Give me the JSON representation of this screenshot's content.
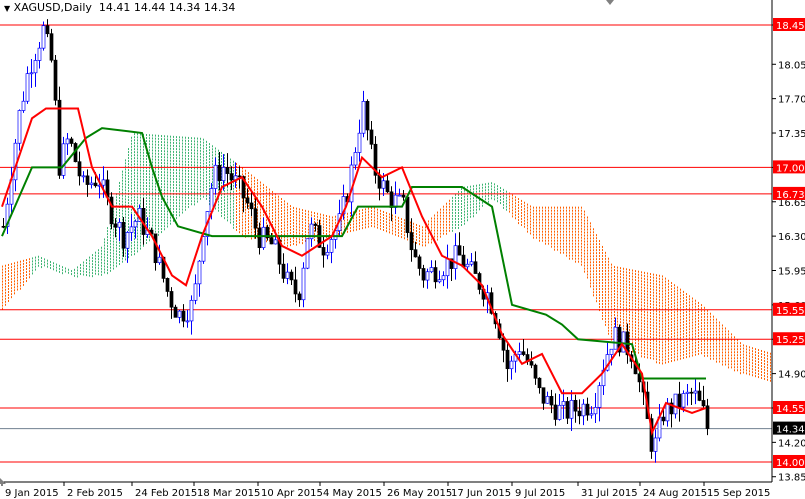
{
  "header": {
    "arrow_icon": "triangle-down",
    "symbol": "XAGUSD,Daily",
    "ohlc": "14.41 14.44 14.34 14.34"
  },
  "chart_data": {
    "type": "candlestick",
    "title": "XAGUSD,Daily",
    "ylim": [
      13.85,
      18.45
    ],
    "yticks": [
      "18.45",
      "18.05",
      "17.70",
      "17.35",
      "17.00",
      "16.65",
      "16.30",
      "15.95",
      "15.60",
      "15.25",
      "14.90",
      "14.55",
      "14.20",
      "13.85"
    ],
    "xlim_days": [
      0,
      193
    ],
    "xticks": [
      {
        "day": 0,
        "label": "9 Jan 2015"
      },
      {
        "day": 15.5,
        "label": "2 Feb 2015"
      },
      {
        "day": 32.5,
        "label": "24 Feb 2015"
      },
      {
        "day": 48,
        "label": "18 Mar 2015"
      },
      {
        "day": 64,
        "label": "10 Apr 2015"
      },
      {
        "day": 79.5,
        "label": "4 May 2015"
      },
      {
        "day": 95.5,
        "label": "26 May 2015"
      },
      {
        "day": 111.5,
        "label": "17 Jun 2015"
      },
      {
        "day": 127.5,
        "label": "9 Jul 2015"
      },
      {
        "day": 144,
        "label": "31 Jul 2015"
      },
      {
        "day": 159.5,
        "label": "24 Aug 2015"
      },
      {
        "day": 175.5,
        "label": "15 Sep 2015"
      }
    ],
    "close_path": [
      [
        0,
        16.4
      ],
      [
        3.8,
        17.5
      ],
      [
        6.3,
        18.0
      ],
      [
        10,
        18.4
      ],
      [
        12.5,
        18.0
      ],
      [
        13.8,
        17.0
      ],
      [
        16.3,
        17.3
      ],
      [
        20,
        16.8
      ],
      [
        23.8,
        16.9
      ],
      [
        26.3,
        16.6
      ],
      [
        30,
        16.3
      ],
      [
        33.8,
        16.5
      ],
      [
        37.5,
        16.2
      ],
      [
        41.3,
        15.7
      ],
      [
        43.8,
        15.5
      ],
      [
        47.5,
        15.6
      ],
      [
        50,
        16.4
      ],
      [
        52.5,
        16.9
      ],
      [
        55,
        17.0
      ],
      [
        58.8,
        16.8
      ],
      [
        61.3,
        16.6
      ],
      [
        63.8,
        16.3
      ],
      [
        67.5,
        16.2
      ],
      [
        71.3,
        15.8
      ],
      [
        73.8,
        15.7
      ],
      [
        76.3,
        16.4
      ],
      [
        80,
        16.2
      ],
      [
        83.8,
        16.4
      ],
      [
        86.3,
        16.8
      ],
      [
        88.8,
        17.4
      ],
      [
        90,
        17.6
      ],
      [
        92.5,
        17.0
      ],
      [
        96.3,
        16.7
      ],
      [
        100,
        16.6
      ],
      [
        102.5,
        16.1
      ],
      [
        105,
        15.9
      ],
      [
        110,
        16.0
      ],
      [
        113.8,
        16.1
      ],
      [
        117.5,
        15.9
      ],
      [
        121.3,
        15.7
      ],
      [
        123.8,
        15.4
      ],
      [
        126.3,
        14.9
      ],
      [
        128.8,
        15.2
      ],
      [
        131.3,
        15.0
      ],
      [
        133.8,
        14.7
      ],
      [
        136.3,
        14.6
      ],
      [
        140,
        14.5
      ],
      [
        143.8,
        14.55
      ],
      [
        147.5,
        14.6
      ],
      [
        150,
        15.0
      ],
      [
        152.5,
        15.3
      ],
      [
        155,
        15.2
      ],
      [
        157.5,
        15.1
      ],
      [
        160,
        14.6
      ],
      [
        162.5,
        14.1
      ],
      [
        165,
        14.5
      ],
      [
        168.8,
        14.6
      ],
      [
        172.5,
        14.7
      ],
      [
        175,
        14.5
      ],
      [
        176,
        14.34
      ]
    ],
    "tenkan": [
      [
        0,
        16.6
      ],
      [
        7.5,
        17.5
      ],
      [
        11,
        17.6
      ],
      [
        19,
        17.6
      ],
      [
        22.5,
        17.0
      ],
      [
        27.5,
        16.6
      ],
      [
        32.5,
        16.6
      ],
      [
        37.5,
        16.3
      ],
      [
        42.5,
        15.9
      ],
      [
        46,
        15.8
      ],
      [
        50,
        16.3
      ],
      [
        55,
        16.8
      ],
      [
        60,
        16.9
      ],
      [
        65,
        16.6
      ],
      [
        70,
        16.2
      ],
      [
        75,
        16.1
      ],
      [
        82.5,
        16.3
      ],
      [
        86,
        16.6
      ],
      [
        90,
        17.1
      ],
      [
        95,
        16.9
      ],
      [
        100,
        17.0
      ],
      [
        105,
        16.5
      ],
      [
        110,
        16.1
      ],
      [
        115,
        16.0
      ],
      [
        120,
        15.8
      ],
      [
        125,
        15.3
      ],
      [
        130,
        15.0
      ],
      [
        135,
        15.1
      ],
      [
        140,
        14.7
      ],
      [
        145,
        14.7
      ],
      [
        150,
        14.9
      ],
      [
        155,
        15.2
      ],
      [
        160,
        14.9
      ],
      [
        162.5,
        14.3
      ],
      [
        166,
        14.6
      ],
      [
        172.5,
        14.5
      ],
      [
        176,
        14.55
      ]
    ],
    "kijun": [
      [
        0,
        16.3
      ],
      [
        7.5,
        17.0
      ],
      [
        15,
        17.0
      ],
      [
        21,
        17.3
      ],
      [
        25,
        17.4
      ],
      [
        35,
        17.35
      ],
      [
        37.5,
        17.0
      ],
      [
        40,
        16.7
      ],
      [
        44,
        16.4
      ],
      [
        52.5,
        16.3
      ],
      [
        85,
        16.3
      ],
      [
        89,
        16.6
      ],
      [
        100,
        16.6
      ],
      [
        102.5,
        16.8
      ],
      [
        115,
        16.8
      ],
      [
        122.5,
        16.6
      ],
      [
        125,
        16.1
      ],
      [
        127.5,
        15.6
      ],
      [
        136,
        15.5
      ],
      [
        140,
        15.4
      ],
      [
        144,
        15.25
      ],
      [
        157.5,
        15.2
      ],
      [
        160,
        14.85
      ],
      [
        176,
        14.85
      ]
    ],
    "cloud": [
      [
        0,
        16.0,
        15.55
      ],
      [
        9,
        16.1,
        16.0
      ],
      [
        17.5,
        15.95,
        15.9
      ],
      [
        25,
        16.2,
        15.9
      ],
      [
        32.5,
        17.35,
        16.1
      ],
      [
        50,
        17.3,
        16.7
      ],
      [
        60,
        17.0,
        16.3
      ],
      [
        72.5,
        16.6,
        16.2
      ],
      [
        82.5,
        16.5,
        16.3
      ],
      [
        92.5,
        16.6,
        16.4
      ],
      [
        105,
        16.4,
        16.2
      ],
      [
        115,
        16.8,
        16.4
      ],
      [
        122.5,
        16.85,
        16.7
      ],
      [
        132.5,
        16.6,
        16.3
      ],
      [
        145,
        16.6,
        16.0
      ],
      [
        152.5,
        16.0,
        15.2
      ],
      [
        165,
        15.9,
        15.0
      ],
      [
        175,
        15.6,
        15.1
      ],
      [
        185,
        15.2,
        14.9
      ],
      [
        193,
        15.1,
        14.8
      ]
    ],
    "cloud_bullish_ranges": [
      [
        7,
        30
      ],
      [
        30,
        58
      ],
      [
        112,
        126
      ]
    ],
    "levels": [
      {
        "price": "18.45",
        "color": "#ff0000"
      },
      {
        "price": "17.00",
        "color": "#ff0000"
      },
      {
        "price": "16.73",
        "color": "#ff0000"
      },
      {
        "price": "15.55",
        "color": "#ff0000"
      },
      {
        "price": "15.25",
        "color": "#ff0000"
      },
      {
        "price": "14.55",
        "color": "#ff0000"
      },
      {
        "price": "14.00",
        "color": "#ff0000"
      }
    ],
    "current_price": {
      "price": "14.34",
      "color": "#000000"
    },
    "colors": {
      "bull": "#0000ff",
      "bear": "#000000",
      "tenkan": "#ff0000",
      "kijun": "#008000",
      "cloud_bull": "#3cb371",
      "cloud_bear": "#ff6000",
      "level": "#ff0000"
    }
  }
}
